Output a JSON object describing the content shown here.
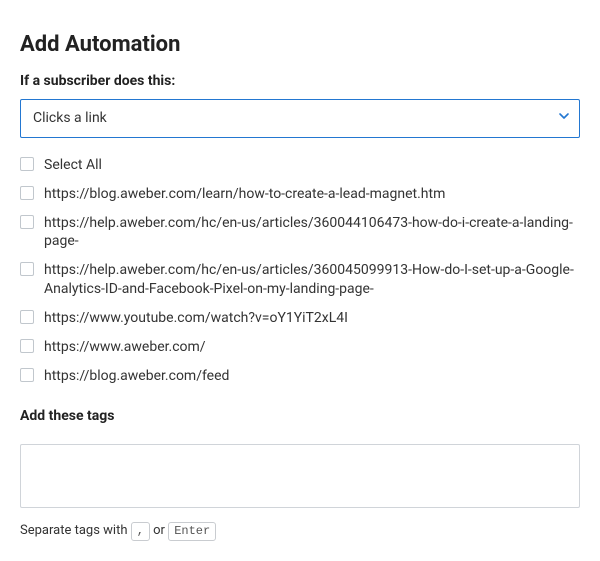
{
  "title": "Add Automation",
  "trigger": {
    "label": "If a subscriber does this:",
    "selected": "Clicks a link"
  },
  "links": {
    "selectAllLabel": "Select All",
    "items": [
      "https://blog.aweber.com/learn/how-to-create-a-lead-magnet.htm",
      "https://help.aweber.com/hc/en-us/articles/360044106473-how-do-i-create-a-landing-page-",
      "https://help.aweber.com/hc/en-us/articles/360045099913-How-do-I-set-up-a-Google-Analytics-ID-and-Facebook-Pixel-on-my-landing-page-",
      "https://www.youtube.com/watch?v=oY1YiT2xL4I",
      "https://www.aweber.com/",
      "https://blog.aweber.com/feed"
    ]
  },
  "tags": {
    "label": "Add these tags",
    "value": "",
    "hint_prefix": "Separate tags with ",
    "hint_key1": ",",
    "hint_or": " or ",
    "hint_key2": "Enter"
  },
  "colors": {
    "accent": "#2377d1"
  }
}
